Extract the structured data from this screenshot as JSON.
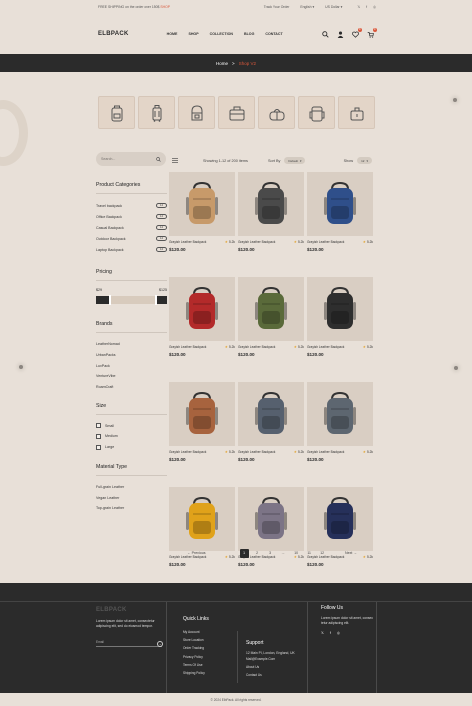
{
  "topbar": {
    "promo_prefix": "FREE SHIPPING on the order over 150$",
    "promo_highlight": "SHOP",
    "track_order": "Track Your Order",
    "language": "English",
    "currency": "US Dollar"
  },
  "header": {
    "logo": "ELBPACK",
    "nav": [
      "HOME",
      "SHOP",
      "COLLECTION",
      "BLOG",
      "CONTACT"
    ],
    "wishlist_count": "0",
    "cart_count": "0"
  },
  "breadcrumb": {
    "home": "Home",
    "current": "Shop V2"
  },
  "search": {
    "placeholder": "Search..."
  },
  "sidebar": {
    "categories_title": "Product Categories",
    "categories": [
      {
        "label": "Travel backpack",
        "count": "14"
      },
      {
        "label": "Office Backpack",
        "count": "14"
      },
      {
        "label": "Casual Backpack",
        "count": "14"
      },
      {
        "label": "Outdoor Backpack",
        "count": "14"
      },
      {
        "label": "Laptop Backpack",
        "count": "14"
      }
    ],
    "pricing_title": "Pricing",
    "price_min": "$29",
    "price_max": "$125",
    "brands_title": "Brands",
    "brands": [
      "LeatherNomad",
      "UrbanPacks",
      "LuxPack",
      "VentureVibe",
      "RoamCraft"
    ],
    "size_title": "Size",
    "sizes": [
      "Small",
      "Medium",
      "Large"
    ],
    "material_title": "Material Type",
    "materials": [
      "Full-grain Leather",
      "Vegan Leather",
      "Top-grain Leather"
    ]
  },
  "toolbar": {
    "showing": "Showing 1-12 of 200 items",
    "sort_label": "Sort By",
    "sort_value": "Default",
    "show_label": "Show",
    "show_value": "12"
  },
  "products": [
    {
      "name": "Grayish Leather Backpack",
      "rating": "5.2k",
      "price": "$120.00",
      "color": "#c79a6a"
    },
    {
      "name": "Grayish Leather Backpack",
      "rating": "5.2k",
      "price": "$120.00",
      "color": "#4a4a4a"
    },
    {
      "name": "Grayish Leather Backpack",
      "rating": "5.2k",
      "price": "$120.00",
      "color": "#2f4f8a"
    },
    {
      "name": "Grayish Leather Backpack",
      "rating": "5.2k",
      "price": "$120.00",
      "color": "#b32a2a"
    },
    {
      "name": "Grayish Leather Backpack",
      "rating": "5.2k",
      "price": "$120.00",
      "color": "#5a6a3a"
    },
    {
      "name": "Grayish Leather Backpack",
      "rating": "5.2k",
      "price": "$120.00",
      "color": "#2e2e2e"
    },
    {
      "name": "Grayish Leather Backpack",
      "rating": "5.2k",
      "price": "$120.00",
      "color": "#a7633e"
    },
    {
      "name": "Grayish Leather Backpack",
      "rating": "5.2k",
      "price": "$120.00",
      "color": "#56606e"
    },
    {
      "name": "Grayish Leather Backpack",
      "rating": "5.2k",
      "price": "$120.00",
      "color": "#5d6670"
    },
    {
      "name": "Grayish Leather Backpack",
      "rating": "5.2k",
      "price": "$120.00",
      "color": "#e0a21a"
    },
    {
      "name": "Grayish Leather Backpack",
      "rating": "5.2k",
      "price": "$120.00",
      "color": "#7c7486"
    },
    {
      "name": "Grayish Leather Backpack",
      "rating": "5.2k",
      "price": "$120.00",
      "color": "#26305a"
    }
  ],
  "pagination": {
    "prev": "Previous",
    "next": "Next",
    "pages": [
      "1",
      "2",
      "3",
      "...",
      "10",
      "11",
      "12"
    ]
  },
  "footer": {
    "logo": "ELBPACK",
    "about": "Lorem ipsum dolor sit amet, consectetur adipiscing elit, sed do eiusmod tempor.",
    "email_label": "Email",
    "quick_links_title": "Quick Links",
    "quick_links": [
      "My Account",
      "Store Location",
      "Order Tracking",
      "Privacy Policy",
      "Terms Of Use",
      "Shipping Policy"
    ],
    "support_title": "Support",
    "support_address": "12 Main Pl, London, England, UK",
    "support_email": "Mail@Example.Com",
    "support_links": [
      "About Us",
      "Contact Us"
    ],
    "follow_title": "Follow Us",
    "follow_text": "Lorem ipsum dolor sit amet, consec tetur adipiscing elit.",
    "copyright": "© 2024 ElbPack. All rights reserved."
  },
  "colors": {
    "accent": "#d9573a",
    "dark": "#2b2b2b",
    "background": "#e8e0d8"
  }
}
